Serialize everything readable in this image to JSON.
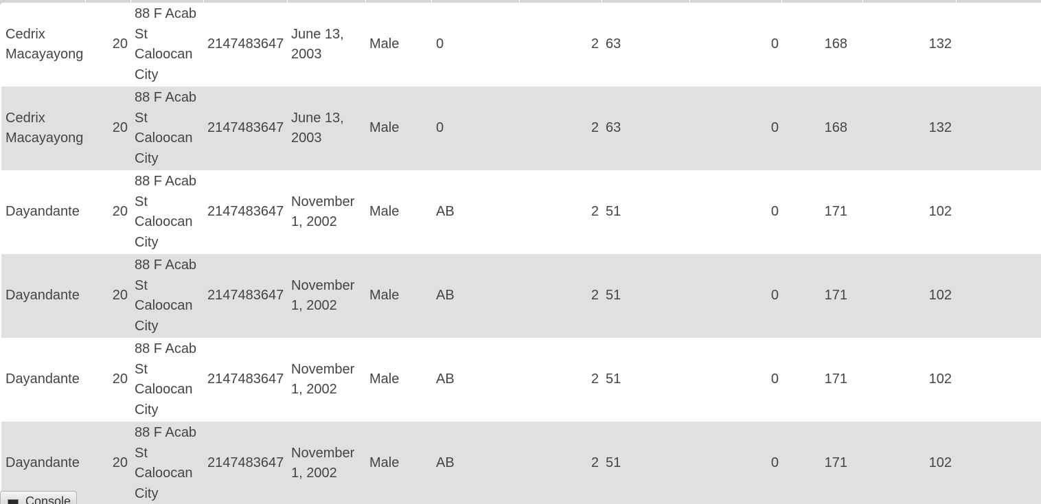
{
  "table": {
    "rows": [
      {
        "name": "Cedrix Macayayong",
        "age": "20",
        "address": "88 F Acab St Caloocan City",
        "contact": "2147483647",
        "birthdate": "June 13, 2003",
        "gender": "Male",
        "blood_type": "0",
        "c8": "2",
        "c9": "63",
        "c10": "0",
        "c11": "168",
        "c12": "132"
      },
      {
        "name": "Cedrix Macayayong",
        "age": "20",
        "address": "88 F Acab St Caloocan City",
        "contact": "2147483647",
        "birthdate": "June 13, 2003",
        "gender": "Male",
        "blood_type": "0",
        "c8": "2",
        "c9": "63",
        "c10": "0",
        "c11": "168",
        "c12": "132"
      },
      {
        "name": "Dayandante",
        "age": "20",
        "address": "88 F Acab St Caloocan City",
        "contact": "2147483647",
        "birthdate": "November 1, 2002",
        "gender": "Male",
        "blood_type": "AB",
        "c8": "2",
        "c9": "51",
        "c10": "0",
        "c11": "171",
        "c12": "102"
      },
      {
        "name": "Dayandante",
        "age": "20",
        "address": "88 F Acab St Caloocan City",
        "contact": "2147483647",
        "birthdate": "November 1, 2002",
        "gender": "Male",
        "blood_type": "AB",
        "c8": "2",
        "c9": "51",
        "c10": "0",
        "c11": "171",
        "c12": "102"
      },
      {
        "name": "Dayandante",
        "age": "20",
        "address": "88 F Acab St Caloocan City",
        "contact": "2147483647",
        "birthdate": "November 1, 2002",
        "gender": "Male",
        "blood_type": "AB",
        "c8": "2",
        "c9": "51",
        "c10": "0",
        "c11": "171",
        "c12": "102"
      },
      {
        "name": "Dayandante",
        "age": "20",
        "address": "88 F Acab St Caloocan City",
        "contact": "2147483647",
        "birthdate": "November 1, 2002",
        "gender": "Male",
        "blood_type": "AB",
        "c8": "2",
        "c9": "51",
        "c10": "0",
        "c11": "171",
        "c12": "102"
      }
    ]
  },
  "console": {
    "label": "Console",
    "icon": "console-icon"
  },
  "colors": {
    "row_alt": "#e0e0e0",
    "row_base": "#ffffff",
    "text": "#444444"
  }
}
